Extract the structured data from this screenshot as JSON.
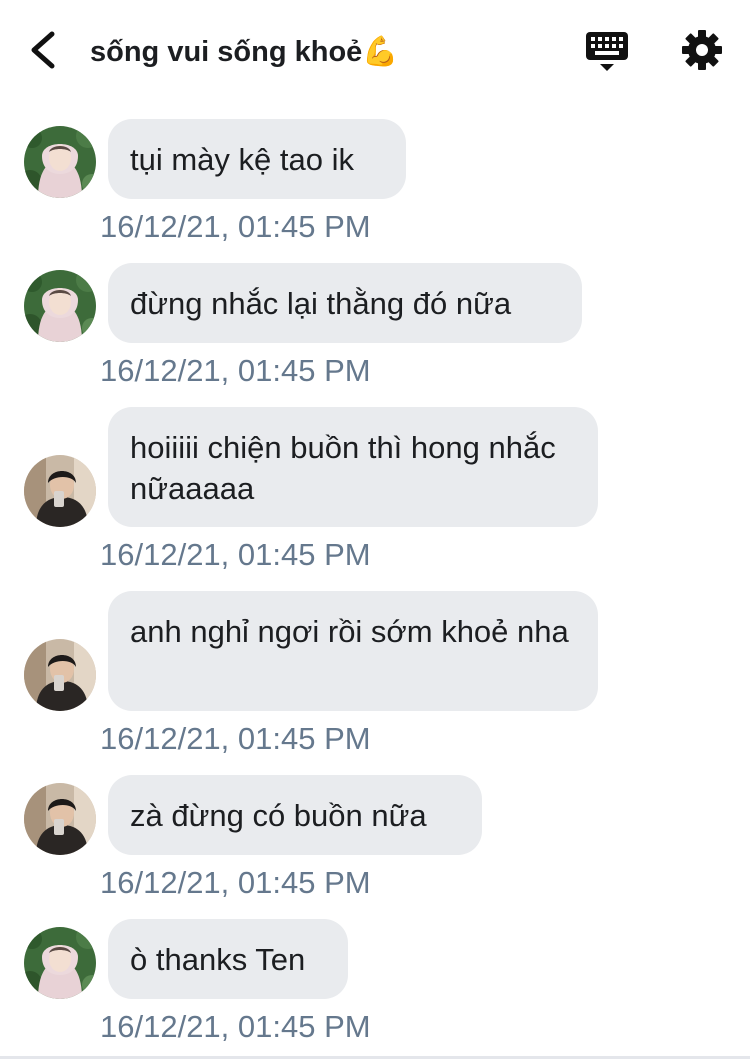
{
  "header": {
    "title": "sống vui sống khoẻ",
    "title_emoji": "💪",
    "back_icon": "chevron-left-icon",
    "keyboard_icon": "keyboard-icon",
    "settings_icon": "gear-icon"
  },
  "messages": [
    {
      "sender": "avatar-a",
      "text": "tụi mày kệ tao ik",
      "time": "16/12/21, 01:45 PM"
    },
    {
      "sender": "avatar-a",
      "text": "đừng nhắc lại thằng đó nữa",
      "time": "16/12/21, 01:45 PM"
    },
    {
      "sender": "avatar-b",
      "text": "hoiiiii chiện buồn thì hong nhắc nữaaaaa",
      "time": "16/12/21, 01:45 PM"
    },
    {
      "sender": "avatar-b",
      "text": "anh nghỉ ngơi rồi sớm khoẻ nha",
      "time": "16/12/21, 01:45 PM"
    },
    {
      "sender": "avatar-b",
      "text": "zà đừng có buồn nữa",
      "time": "16/12/21, 01:45 PM"
    },
    {
      "sender": "avatar-a",
      "text": "ò thanks Ten",
      "time": "16/12/21, 01:45 PM"
    }
  ],
  "colors": {
    "bubble": "#e9ebee",
    "timestamp": "#65788d",
    "text": "#1c1e21"
  }
}
